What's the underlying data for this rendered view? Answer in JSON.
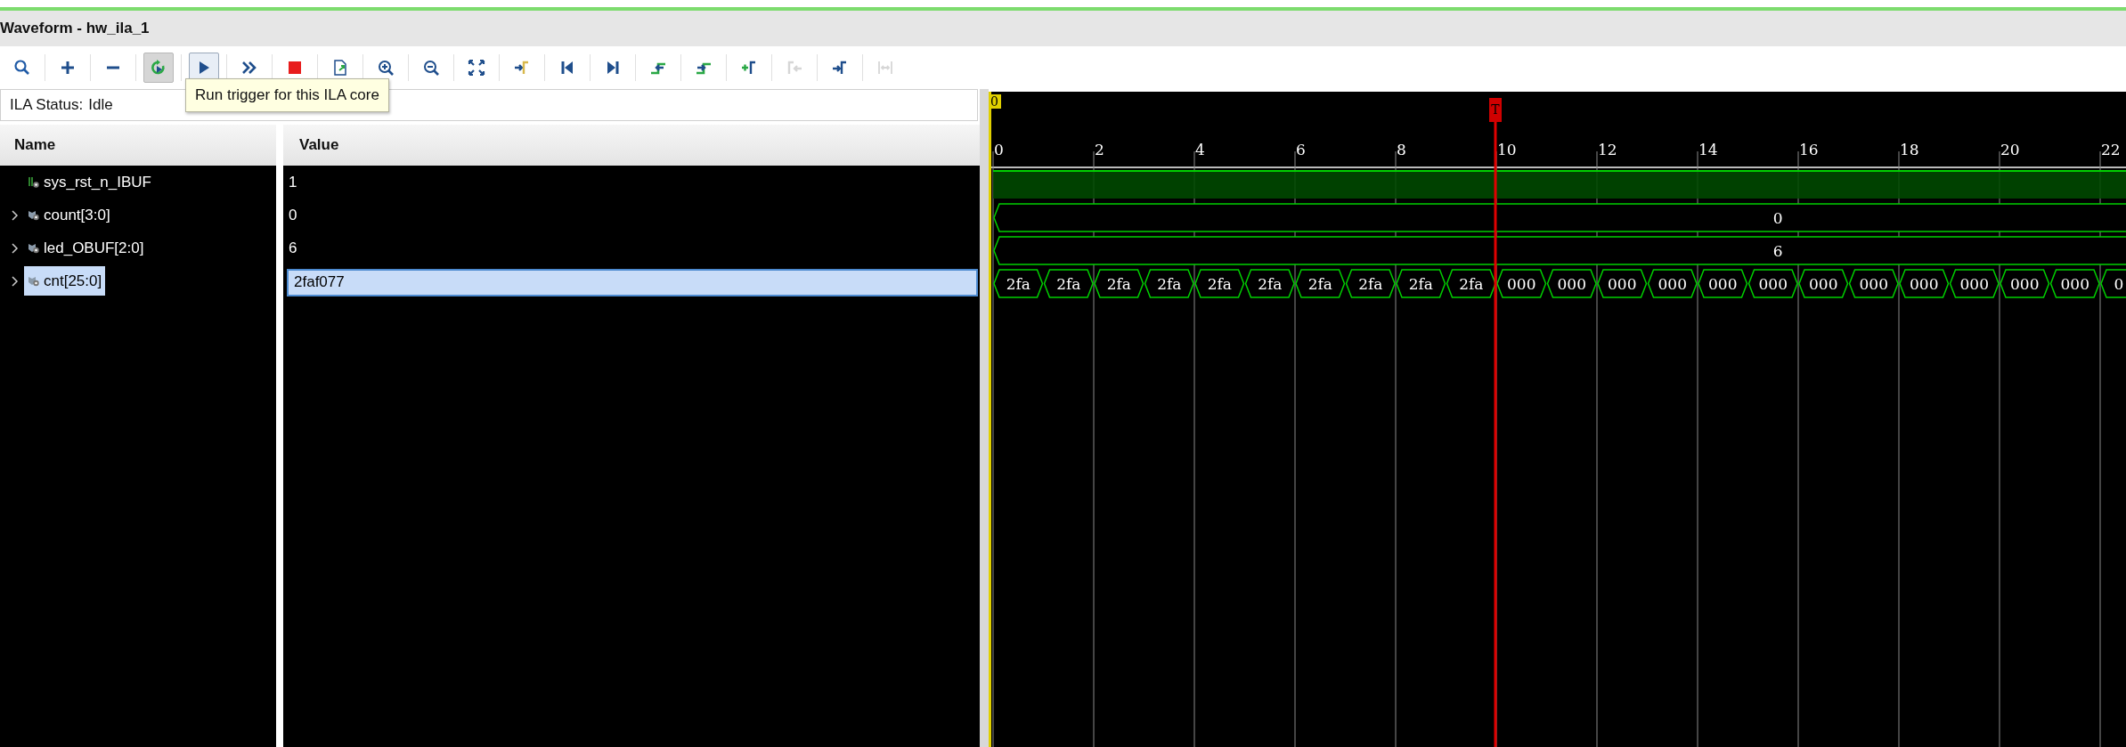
{
  "window": {
    "title": "Waveform - hw_ila_1"
  },
  "toolbar": [
    {
      "kind": "search",
      "toggled": false,
      "hovered": false,
      "disabled": false
    },
    {
      "kind": "add",
      "toggled": false,
      "hovered": false,
      "disabled": false
    },
    {
      "kind": "remove",
      "toggled": false,
      "hovered": false,
      "disabled": false
    },
    {
      "kind": "auto_retrigger",
      "toggled": true,
      "hovered": false,
      "disabled": false
    },
    {
      "kind": "run",
      "toggled": false,
      "hovered": true,
      "disabled": false
    },
    {
      "kind": "run_immediate",
      "toggled": false,
      "hovered": false,
      "disabled": false
    },
    {
      "kind": "stop",
      "toggled": false,
      "hovered": false,
      "disabled": false
    },
    {
      "kind": "export",
      "toggled": false,
      "hovered": false,
      "disabled": false
    },
    {
      "kind": "zoom_in",
      "toggled": false,
      "hovered": false,
      "disabled": false
    },
    {
      "kind": "zoom_out",
      "toggled": false,
      "hovered": false,
      "disabled": false
    },
    {
      "kind": "zoom_fit",
      "toggled": false,
      "hovered": false,
      "disabled": false
    },
    {
      "kind": "goto_cursor",
      "toggled": false,
      "hovered": false,
      "disabled": false
    },
    {
      "kind": "go_start",
      "toggled": false,
      "hovered": false,
      "disabled": false
    },
    {
      "kind": "go_end",
      "toggled": false,
      "hovered": false,
      "disabled": false
    },
    {
      "kind": "prev_transition",
      "toggled": false,
      "hovered": false,
      "disabled": false
    },
    {
      "kind": "next_transition",
      "toggled": false,
      "hovered": false,
      "disabled": false
    },
    {
      "kind": "add_marker",
      "toggled": false,
      "hovered": false,
      "disabled": false
    },
    {
      "kind": "prev_marker",
      "toggled": false,
      "hovered": false,
      "disabled": true
    },
    {
      "kind": "next_marker",
      "toggled": false,
      "hovered": false,
      "disabled": false
    },
    {
      "kind": "swap_cursors",
      "toggled": false,
      "hovered": false,
      "disabled": true
    }
  ],
  "tooltip": {
    "text": "Run trigger for this ILA core"
  },
  "ila_status": {
    "label": "ILA Status:",
    "value": "Idle"
  },
  "columns": [
    "Name",
    "Value"
  ],
  "signals": [
    {
      "name": "sys_rst_n_IBUF",
      "kind": "bit",
      "expandable": false,
      "selected": false,
      "value": "1",
      "wave": {
        "high": true
      }
    },
    {
      "name": "count[3:0]",
      "kind": "bus",
      "expandable": true,
      "selected": false,
      "value": "0",
      "wave": {
        "segments": [
          "0"
        ]
      }
    },
    {
      "name": "led_OBUF[2:0]",
      "kind": "bus",
      "expandable": true,
      "selected": false,
      "value": "6",
      "wave": {
        "segments": [
          "6"
        ]
      }
    },
    {
      "name": "cnt[25:0]",
      "kind": "bus",
      "expandable": true,
      "selected": true,
      "value": "2faf077",
      "wave": {
        "segments": [
          "2fa",
          "2fa",
          "2fa",
          "2fa",
          "2fa",
          "2fa",
          "2fa",
          "2fa",
          "2fa",
          "2fa",
          "000",
          "000",
          "000",
          "000",
          "000",
          "000",
          "000",
          "000",
          "000",
          "000",
          "000",
          "000",
          "0"
        ]
      }
    }
  ],
  "timeline": {
    "ticks": [
      "0",
      "2",
      "4",
      "6",
      "8",
      "10",
      "12",
      "14",
      "16",
      "18",
      "20",
      "22"
    ],
    "cursor_label": "0",
    "trigger_label": "T"
  }
}
